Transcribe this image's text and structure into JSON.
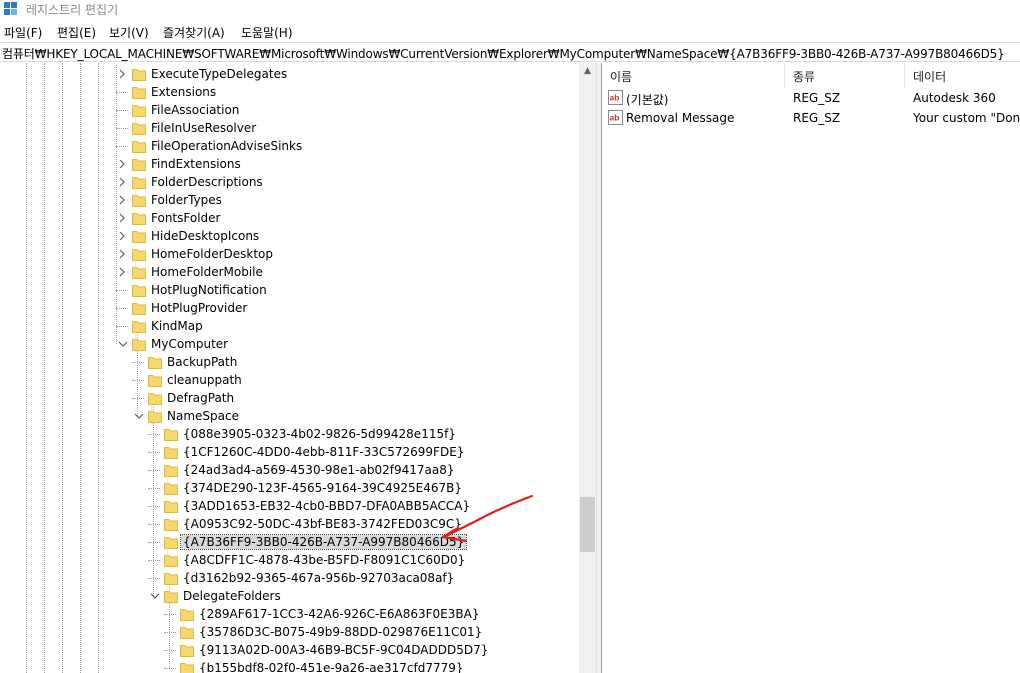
{
  "window": {
    "title": "레지스트리 편집기"
  },
  "menu": [
    "파일(F)",
    "편집(E)",
    "보기(V)",
    "즐겨찾기(A)",
    "도움말(H)"
  ],
  "address": "컴퓨터₩HKEY_LOCAL_MACHINE₩SOFTWARE₩Microsoft₩Windows₩CurrentVersion₩Explorer₩MyComputer₩NameSpace₩{A7B36FF9-3BB0-426B-A737-A997B80466D5}",
  "tree": {
    "top_level": [
      {
        "label": "ExecuteTypeDelegates",
        "expander": "collapsed"
      },
      {
        "label": "Extensions",
        "expander": "none"
      },
      {
        "label": "FileAssociation",
        "expander": "none"
      },
      {
        "label": "FileInUseResolver",
        "expander": "none"
      },
      {
        "label": "FileOperationAdviseSinks",
        "expander": "none"
      },
      {
        "label": "FindExtensions",
        "expander": "collapsed"
      },
      {
        "label": "FolderDescriptions",
        "expander": "collapsed"
      },
      {
        "label": "FolderTypes",
        "expander": "collapsed"
      },
      {
        "label": "FontsFolder",
        "expander": "collapsed"
      },
      {
        "label": "HideDesktopIcons",
        "expander": "collapsed"
      },
      {
        "label": "HomeFolderDesktop",
        "expander": "collapsed"
      },
      {
        "label": "HomeFolderMobile",
        "expander": "collapsed"
      },
      {
        "label": "HotPlugNotification",
        "expander": "none"
      },
      {
        "label": "HotPlugProvider",
        "expander": "none"
      },
      {
        "label": "KindMap",
        "expander": "none"
      },
      {
        "label": "MyComputer",
        "expander": "expanded"
      }
    ],
    "mycomputer_children": [
      {
        "label": "BackupPath",
        "expander": "none"
      },
      {
        "label": "cleanuppath",
        "expander": "none"
      },
      {
        "label": "DefragPath",
        "expander": "none"
      },
      {
        "label": "NameSpace",
        "expander": "expanded"
      }
    ],
    "namespace_children": [
      {
        "label": "{088e3905-0323-4b02-9826-5d99428e115f}"
      },
      {
        "label": "{1CF1260C-4DD0-4ebb-811F-33C572699FDE}"
      },
      {
        "label": "{24ad3ad4-a569-4530-98e1-ab02f9417aa8}"
      },
      {
        "label": "{374DE290-123F-4565-9164-39C4925E467B}"
      },
      {
        "label": "{3ADD1653-EB32-4cb0-BBD7-DFA0ABB5ACCA}"
      },
      {
        "label": "{A0953C92-50DC-43bf-BE83-3742FED03C9C}"
      },
      {
        "label": "{A7B36FF9-3BB0-426B-A737-A997B80466D5}",
        "selected": true
      },
      {
        "label": "{A8CDFF1C-4878-43be-B5FD-F8091C1C60D0}"
      },
      {
        "label": "{d3162b92-9365-467a-956b-92703aca08af}"
      }
    ],
    "delegate_folders": {
      "label": "DelegateFolders",
      "expander": "expanded"
    },
    "delegate_children": [
      {
        "label": "{289AF617-1CC3-42A6-926C-E6A863F0E3BA}"
      },
      {
        "label": "{35786D3C-B075-49b9-88DD-029876E11C01}"
      },
      {
        "label": "{9113A02D-00A3-46B9-BC5F-9C04DADDD5D7}"
      },
      {
        "label": "{b155bdf8-02f0-451e-9a26-ae317cfd7779}"
      }
    ]
  },
  "values_pane": {
    "columns": [
      "이름",
      "종류",
      "데이터"
    ],
    "rows": [
      {
        "name": "(기본값)",
        "type": "REG_SZ",
        "data": "Autodesk 360",
        "icon": "string-value-icon"
      },
      {
        "name": "Removal Message",
        "type": "REG_SZ",
        "data": "Your custom \"Don't",
        "icon": "string-value-icon"
      }
    ]
  },
  "colors": {
    "folder": "#f5d76e",
    "folder_dark": "#e2b93b",
    "selection": "#d9d9d9",
    "annotation": "#e0201c"
  }
}
